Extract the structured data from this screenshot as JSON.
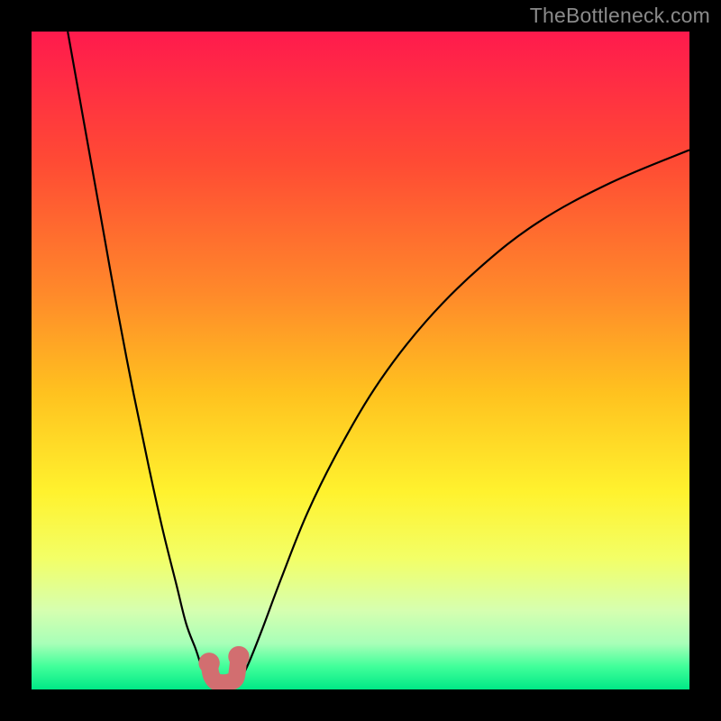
{
  "watermark": "TheBottleneck.com",
  "chart_data": {
    "type": "line",
    "title": "",
    "xlabel": "",
    "ylabel": "",
    "xlim": [
      0,
      100
    ],
    "ylim": [
      0,
      100
    ],
    "grid": false,
    "gradient_stops": [
      {
        "pos": 0.0,
        "color": "#ff1a4d"
      },
      {
        "pos": 0.2,
        "color": "#ff4b34"
      },
      {
        "pos": 0.4,
        "color": "#ff8a2a"
      },
      {
        "pos": 0.55,
        "color": "#ffc21f"
      },
      {
        "pos": 0.7,
        "color": "#fff22e"
      },
      {
        "pos": 0.8,
        "color": "#f3ff66"
      },
      {
        "pos": 0.88,
        "color": "#d6ffb0"
      },
      {
        "pos": 0.93,
        "color": "#a8ffb8"
      },
      {
        "pos": 0.965,
        "color": "#41ff9a"
      },
      {
        "pos": 1.0,
        "color": "#00e886"
      }
    ],
    "series": [
      {
        "name": "left-branch",
        "type": "sharp",
        "x": [
          5.5,
          8.0,
          10.5,
          13.0,
          15.5,
          18.0,
          20.0,
          22.0,
          23.5,
          25.0,
          26.0,
          27.0
        ],
        "y": [
          100.0,
          86.0,
          72.0,
          58.0,
          45.0,
          33.0,
          24.0,
          16.0,
          10.0,
          6.0,
          3.0,
          1.0
        ]
      },
      {
        "name": "right-branch",
        "type": "sharp",
        "x": [
          31.5,
          33.0,
          35.0,
          38.0,
          42.0,
          47.0,
          53.0,
          60.0,
          68.0,
          77.0,
          88.0,
          100.0
        ],
        "y": [
          1.0,
          4.0,
          9.0,
          17.0,
          27.0,
          37.0,
          47.0,
          56.0,
          64.0,
          71.0,
          77.0,
          82.0
        ]
      },
      {
        "name": "bottom-bracket",
        "type": "marked",
        "x": [
          27.0,
          27.3,
          28.0,
          29.0,
          30.0,
          31.0,
          31.3,
          31.5
        ],
        "y": [
          4.0,
          2.2,
          1.2,
          1.0,
          1.1,
          1.6,
          3.0,
          5.0
        ]
      }
    ],
    "bracket_marker_color": "#d26e70",
    "bracket_marker_radius": 1.6
  }
}
